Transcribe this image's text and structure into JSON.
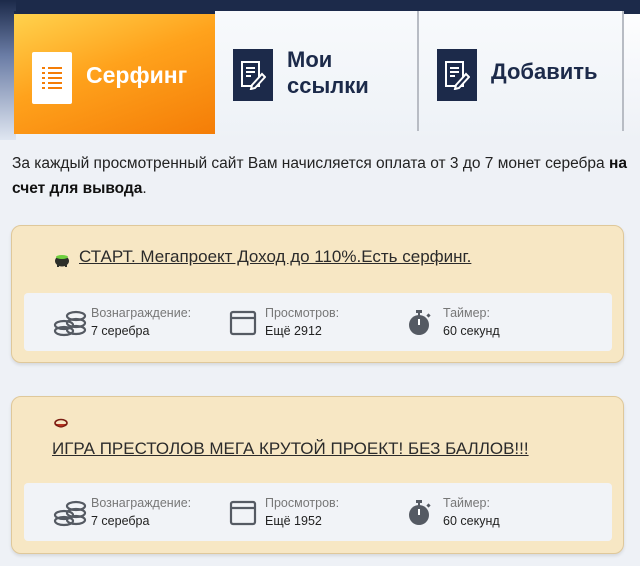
{
  "tabs": [
    {
      "label": "Серфинг",
      "icon": "list-document-icon",
      "active": true
    },
    {
      "label": "Мои ссылки",
      "icon": "edit-document-icon",
      "active": false
    },
    {
      "label": "Добавить",
      "icon": "edit-document-icon",
      "active": false
    }
  ],
  "intro": {
    "text_before": "За каждый просмотренный сайт Вам начисляется оплата от 3 до 7 монет серебра ",
    "text_bold": "на счет для вывода",
    "text_after": "."
  },
  "stat_labels": {
    "reward": "Вознаграждение:",
    "views": "Просмотров:",
    "timer": "Таймер:"
  },
  "sites": [
    {
      "title": "СТАРТ. Мегапроект Доход до 110%.Есть серфинг.",
      "favicon": "cauldron-favicon-icon",
      "reward": "7 серебра",
      "views": "Ещё 2912",
      "timer": "60 секунд"
    },
    {
      "title": "ИГРА ПРЕСТОЛОВ МЕГА КРУТОЙ ПРОЕКТ! БЕЗ БАЛЛОВ!!!",
      "favicon": "bowl-favicon-icon",
      "reward": "7 серебра",
      "views": "Ещё 1952",
      "timer": "60 секунд"
    }
  ],
  "colors": {
    "active_tab": "#ffa21c",
    "navy": "#1c2a4a",
    "card_bg": "#f7e7c4",
    "stats_bg": "#f1f3f7",
    "icon_gray": "#555a63"
  }
}
